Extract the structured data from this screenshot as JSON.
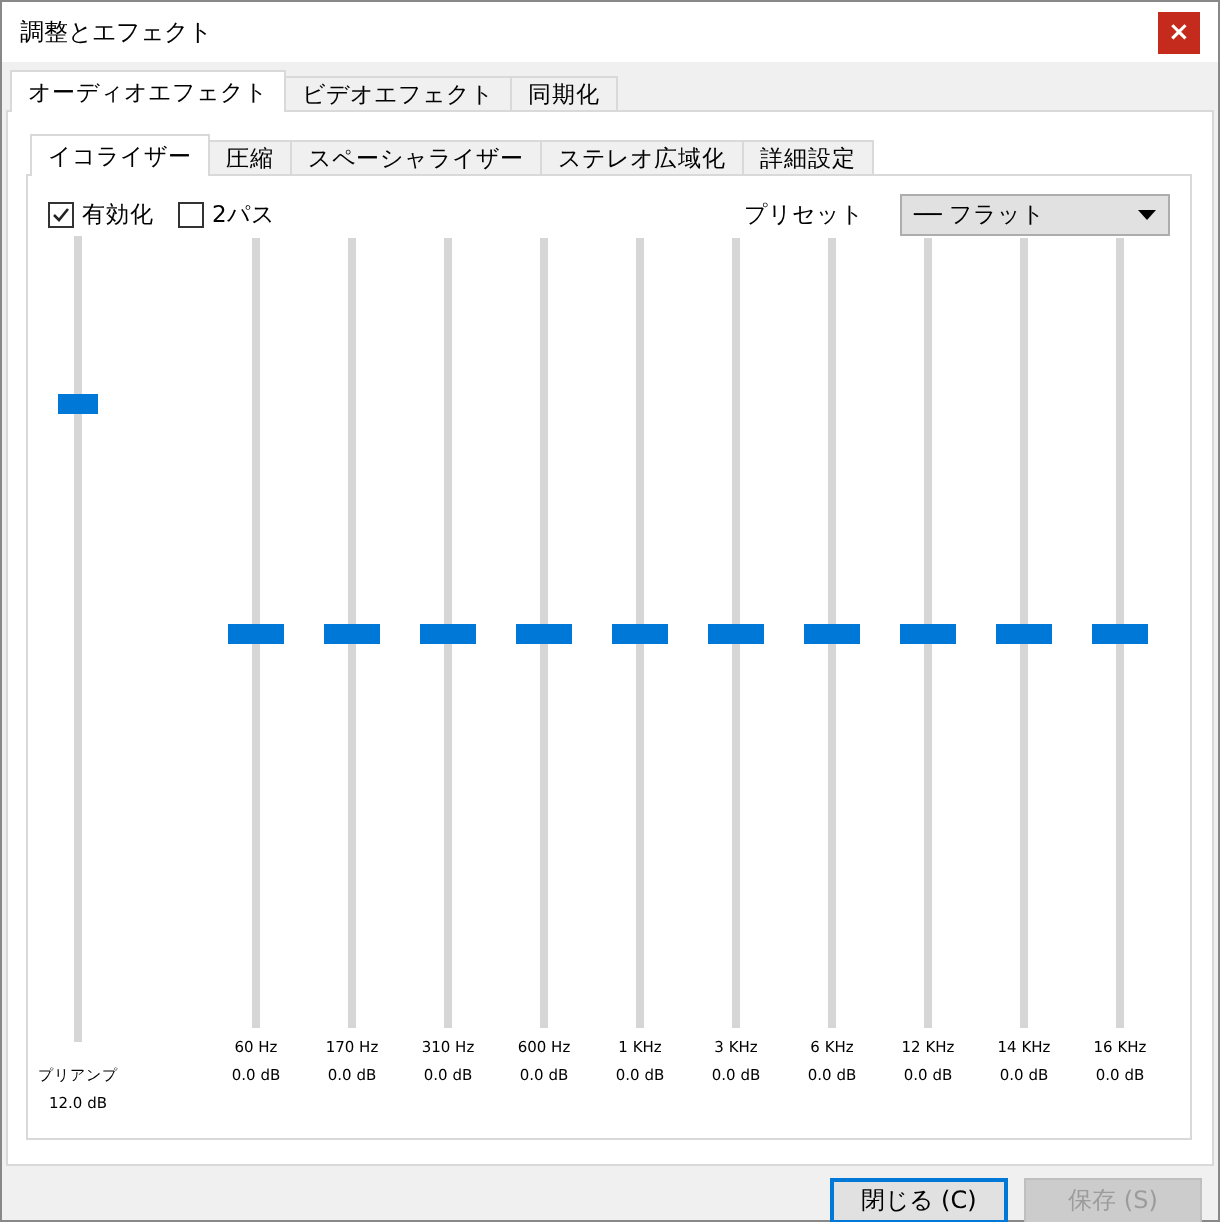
{
  "window": {
    "title": "調整とエフェクト",
    "close": "×"
  },
  "tabs": [
    {
      "label": "オーディオエフェクト",
      "selected": true
    },
    {
      "label": "ビデオエフェクト",
      "selected": false
    },
    {
      "label": "同期化",
      "selected": false
    }
  ],
  "subtabs": [
    {
      "label": "イコライザー",
      "selected": true
    },
    {
      "label": "圧縮",
      "selected": false
    },
    {
      "label": "スペーシャライザー",
      "selected": false
    },
    {
      "label": "ステレオ広域化",
      "selected": false
    },
    {
      "label": "詳細設定",
      "selected": false
    }
  ],
  "options": [
    {
      "label": "有効化",
      "checked": true
    },
    {
      "label": "2パス",
      "checked": false
    }
  ],
  "preset": {
    "label": "プリセット",
    "value": "── フラット"
  },
  "preamp": {
    "label": "プリアンプ",
    "reading": "12.0 dB",
    "level": 0.8
  },
  "bands": [
    {
      "frequency": "60 Hz",
      "reading": "0.0 dB",
      "level": 0.5
    },
    {
      "frequency": "170 Hz",
      "reading": "0.0 dB",
      "level": 0.5
    },
    {
      "frequency": "310 Hz",
      "reading": "0.0 dB",
      "level": 0.5
    },
    {
      "frequency": "600 Hz",
      "reading": "0.0 dB",
      "level": 0.5
    },
    {
      "frequency": "1 KHz",
      "reading": "0.0 dB",
      "level": 0.5
    },
    {
      "frequency": "3 KHz",
      "reading": "0.0 dB",
      "level": 0.5
    },
    {
      "frequency": "6 KHz",
      "reading": "0.0 dB",
      "level": 0.5
    },
    {
      "frequency": "12 KHz",
      "reading": "0.0 dB",
      "level": 0.5
    },
    {
      "frequency": "14 KHz",
      "reading": "0.0 dB",
      "level": 0.5
    },
    {
      "frequency": "16 KHz",
      "reading": "0.0 dB",
      "level": 0.5
    }
  ],
  "buttons": [
    {
      "label": "閉じる (C)",
      "disabled": false,
      "selected": true
    },
    {
      "label": "保存 (S)",
      "disabled": true,
      "selected": false
    }
  ]
}
